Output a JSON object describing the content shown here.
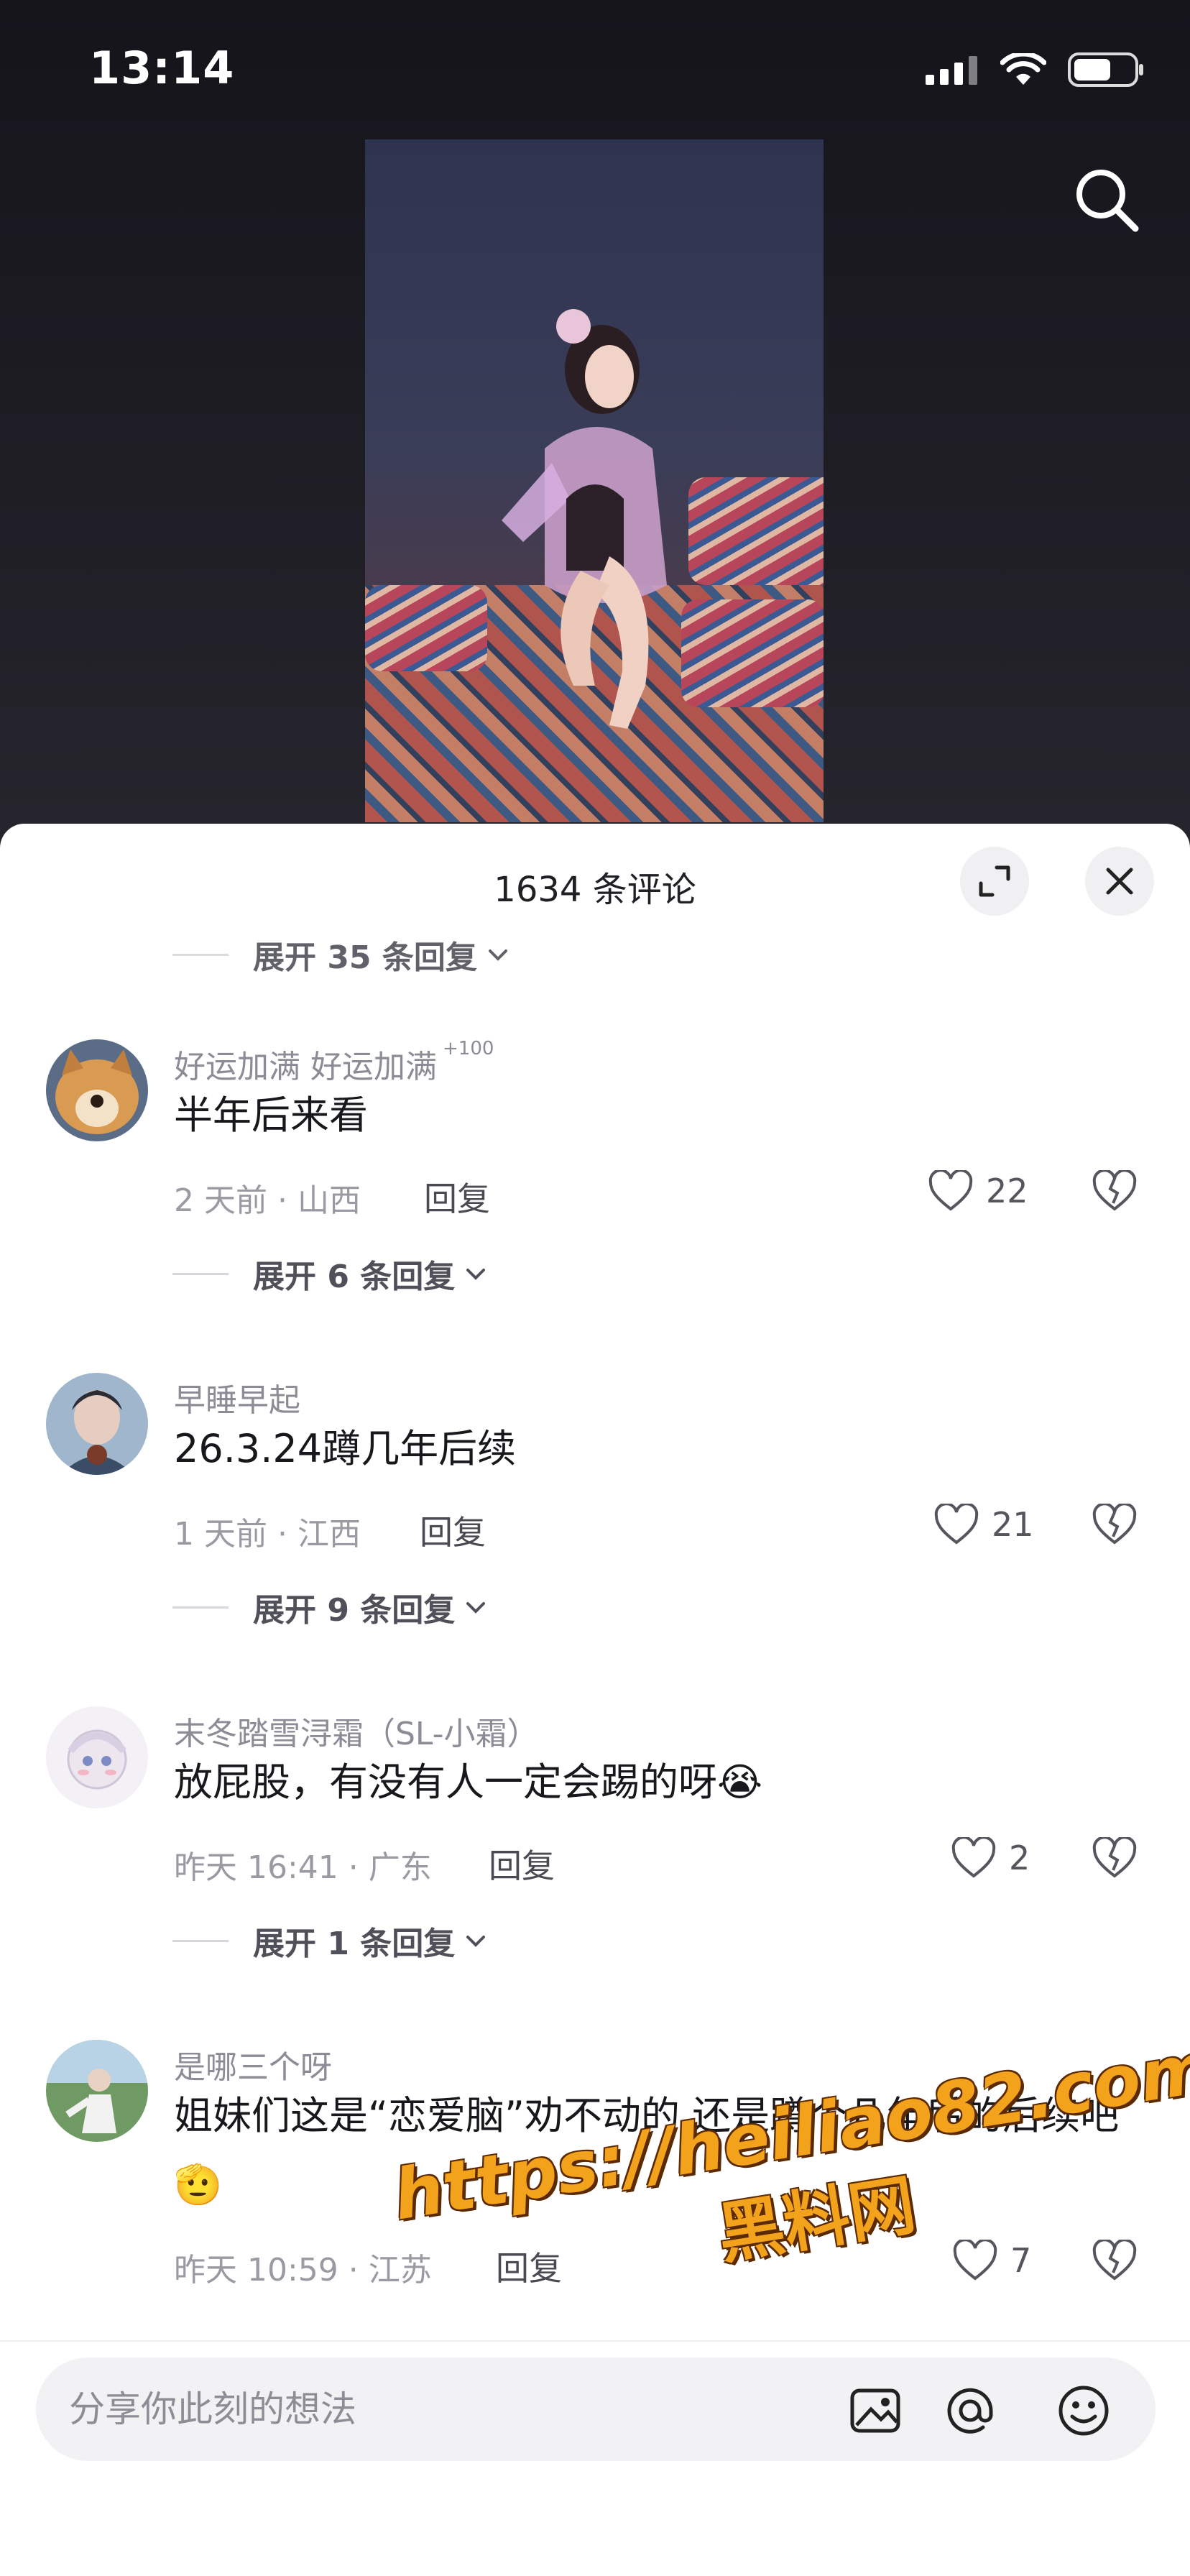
{
  "status_bar": {
    "time": "13:14"
  },
  "colors": {
    "accent_watermark": "#f3a21c",
    "sheet_bg": "#ffffff",
    "meta_text": "#9a9aa3"
  },
  "sheet": {
    "title": "1634 条评论",
    "top_thread_more": "展开 35 条回复",
    "icons": {
      "expand": "fullscreen-icon",
      "close": "close-icon"
    }
  },
  "comments": [
    {
      "name": "好运加满 好运加满",
      "badge": "+100",
      "text": "半年后来看",
      "meta": "2 天前 · 山西",
      "reply": "回复",
      "likes": "22",
      "more": "展开 6 条回复"
    },
    {
      "name": "早睡早起",
      "text": "26.3.24蹲几年后续",
      "meta": "1 天前 · 江西",
      "reply": "回复",
      "likes": "21",
      "more": "展开 9 条回复"
    },
    {
      "name": "末冬踏雪浔霜（SL-小霜）",
      "text": "放屁股，有没有人一定会踢的呀😭",
      "meta": "昨天 16:41 · 广东",
      "reply": "回复",
      "likes": "2",
      "more": "展开 1 条回复"
    },
    {
      "name": "是哪三个呀",
      "text": "姐妹们这是“恋爱脑”劝不动的 还是蹲个几年后的后续吧🫡",
      "meta": "昨天 10:59 · 江苏",
      "reply": "回复",
      "likes": "7"
    }
  ],
  "input": {
    "placeholder": "分享你此刻的想法"
  },
  "watermark": {
    "url": "https://heiliao82.com",
    "name": "黑料网"
  }
}
